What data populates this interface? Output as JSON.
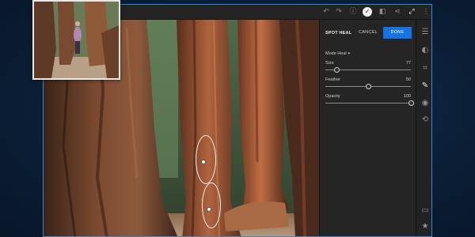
{
  "window": {
    "accent": "#1473e6",
    "border": "#3a84d4"
  },
  "toolbar": {
    "icons": [
      "undo-icon",
      "redo-icon",
      "info-icon",
      "check-icon",
      "compare-icon",
      "share-icon",
      "expand-icon",
      "more-icon"
    ]
  },
  "panel": {
    "title": "SPOT HEAL",
    "cancel_label": "CANCEL",
    "done_label": "DONE",
    "mode_label": "Mode Heal",
    "sliders": [
      {
        "label": "Size",
        "value": "77",
        "fraction": 0.13
      },
      {
        "label": "Feather",
        "value": "50",
        "fraction": 0.5
      },
      {
        "label": "Opacity",
        "value": "100",
        "fraction": 1.0
      }
    ]
  },
  "rail": {
    "icons": [
      "sliders-icon",
      "presets-icon",
      "crop-icon",
      "brush-icon",
      "radial-icon",
      "history-icon",
      "comment-icon",
      "star-icon"
    ]
  },
  "photo": {
    "subject": "redwood-trunks",
    "heal_spots": 2
  }
}
